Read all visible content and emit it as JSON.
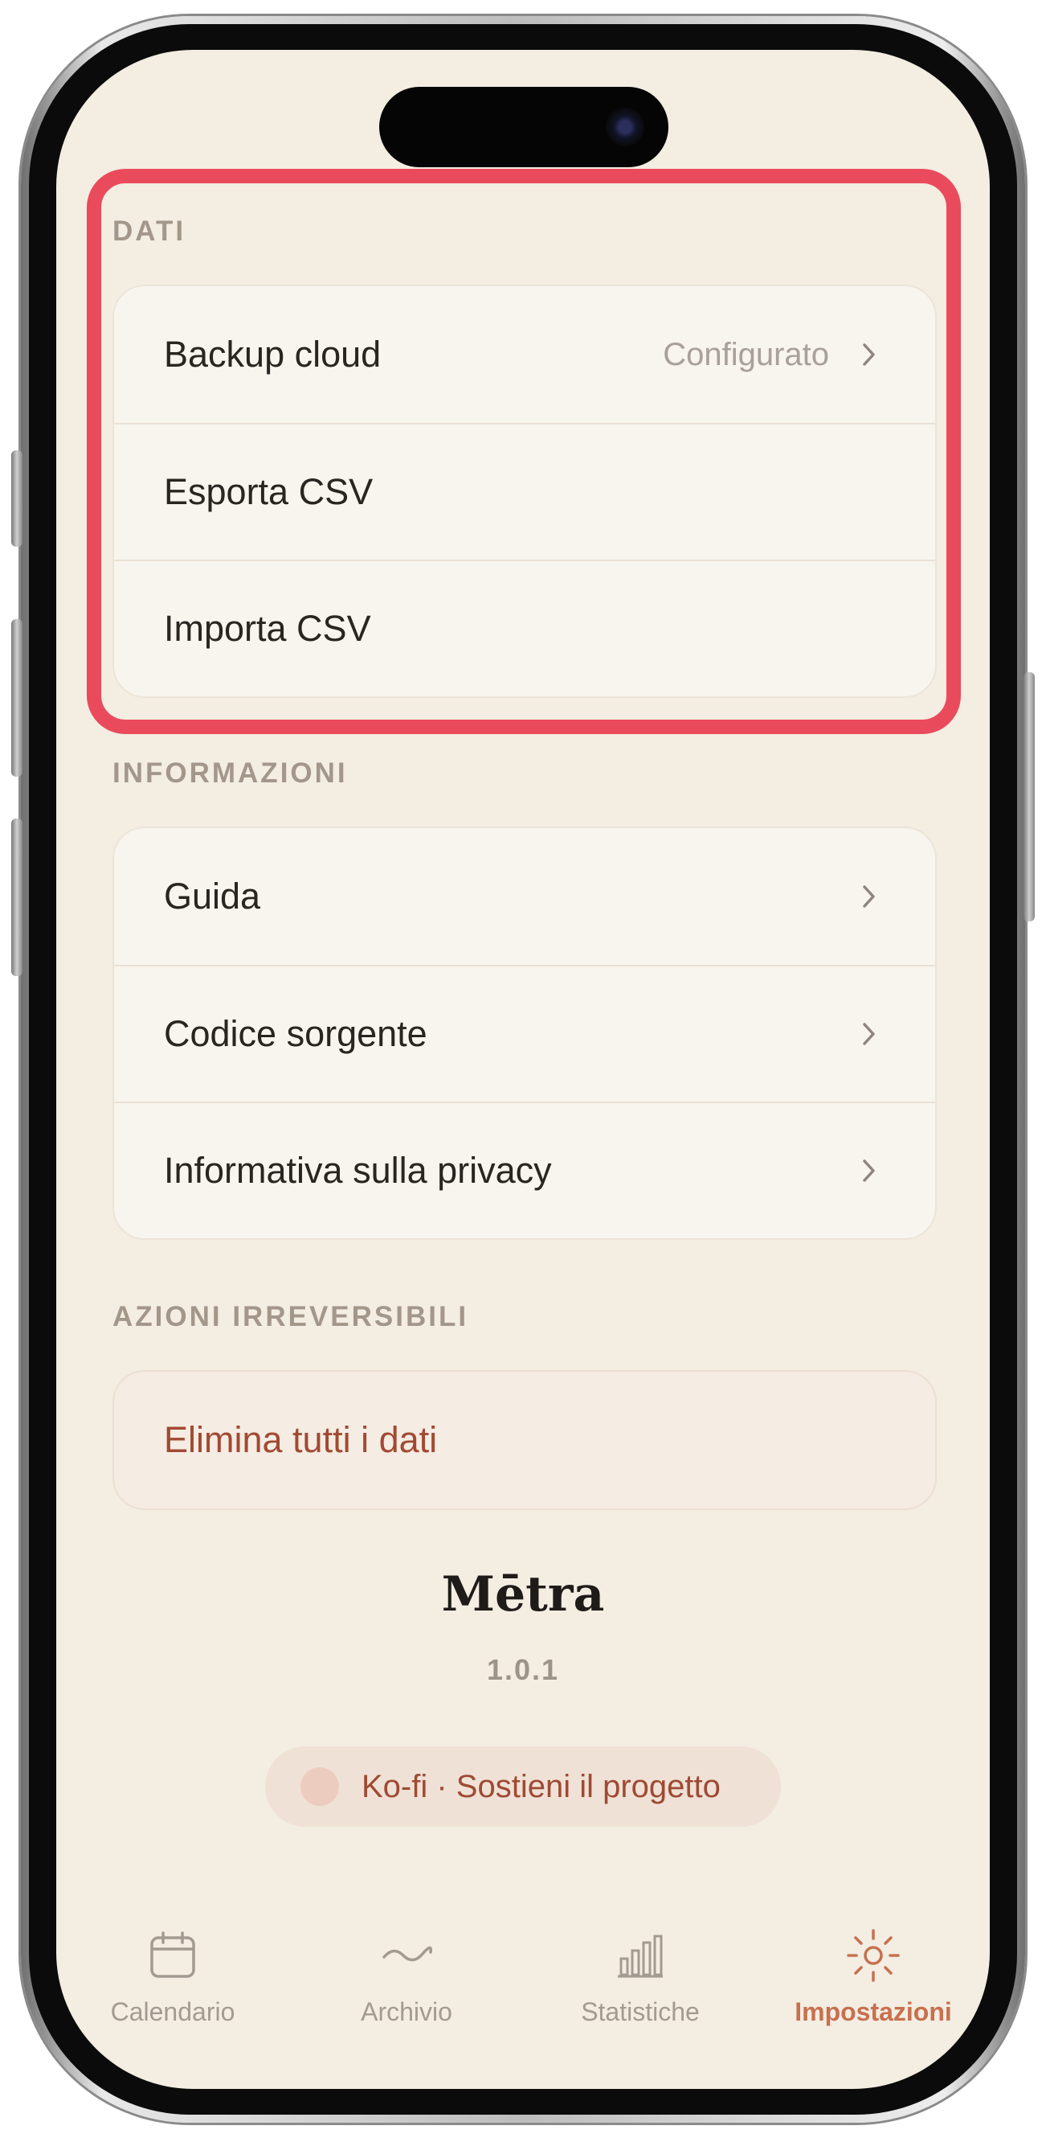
{
  "sections": {
    "dati": {
      "title": "DATI",
      "items": [
        {
          "label": "Backup cloud",
          "value": "Configurato"
        },
        {
          "label": "Esporta CSV"
        },
        {
          "label": "Importa CSV"
        }
      ]
    },
    "informazioni": {
      "title": "INFORMAZIONI",
      "items": [
        {
          "label": "Guida"
        },
        {
          "label": "Codice sorgente"
        },
        {
          "label": "Informativa sulla privacy"
        }
      ]
    },
    "azioni": {
      "title": "AZIONI IRREVERSIBILI",
      "items": [
        {
          "label": "Elimina tutti i dati"
        }
      ]
    }
  },
  "app": {
    "name": "Mētra",
    "version": "1.0.1",
    "kofi_label": "Ko-fi · Sostieni il progetto"
  },
  "tabs": [
    {
      "label": "Calendario",
      "icon": "calendar-icon"
    },
    {
      "label": "Archivio",
      "icon": "wave-icon"
    },
    {
      "label": "Statistiche",
      "icon": "bar-chart-icon"
    },
    {
      "label": "Impostazioni",
      "icon": "sun-icon",
      "active": true
    }
  ],
  "colors": {
    "background": "#f3ede2",
    "accent": "#c7704f",
    "danger": "#a14a33",
    "highlight": "#ea4b5c"
  }
}
